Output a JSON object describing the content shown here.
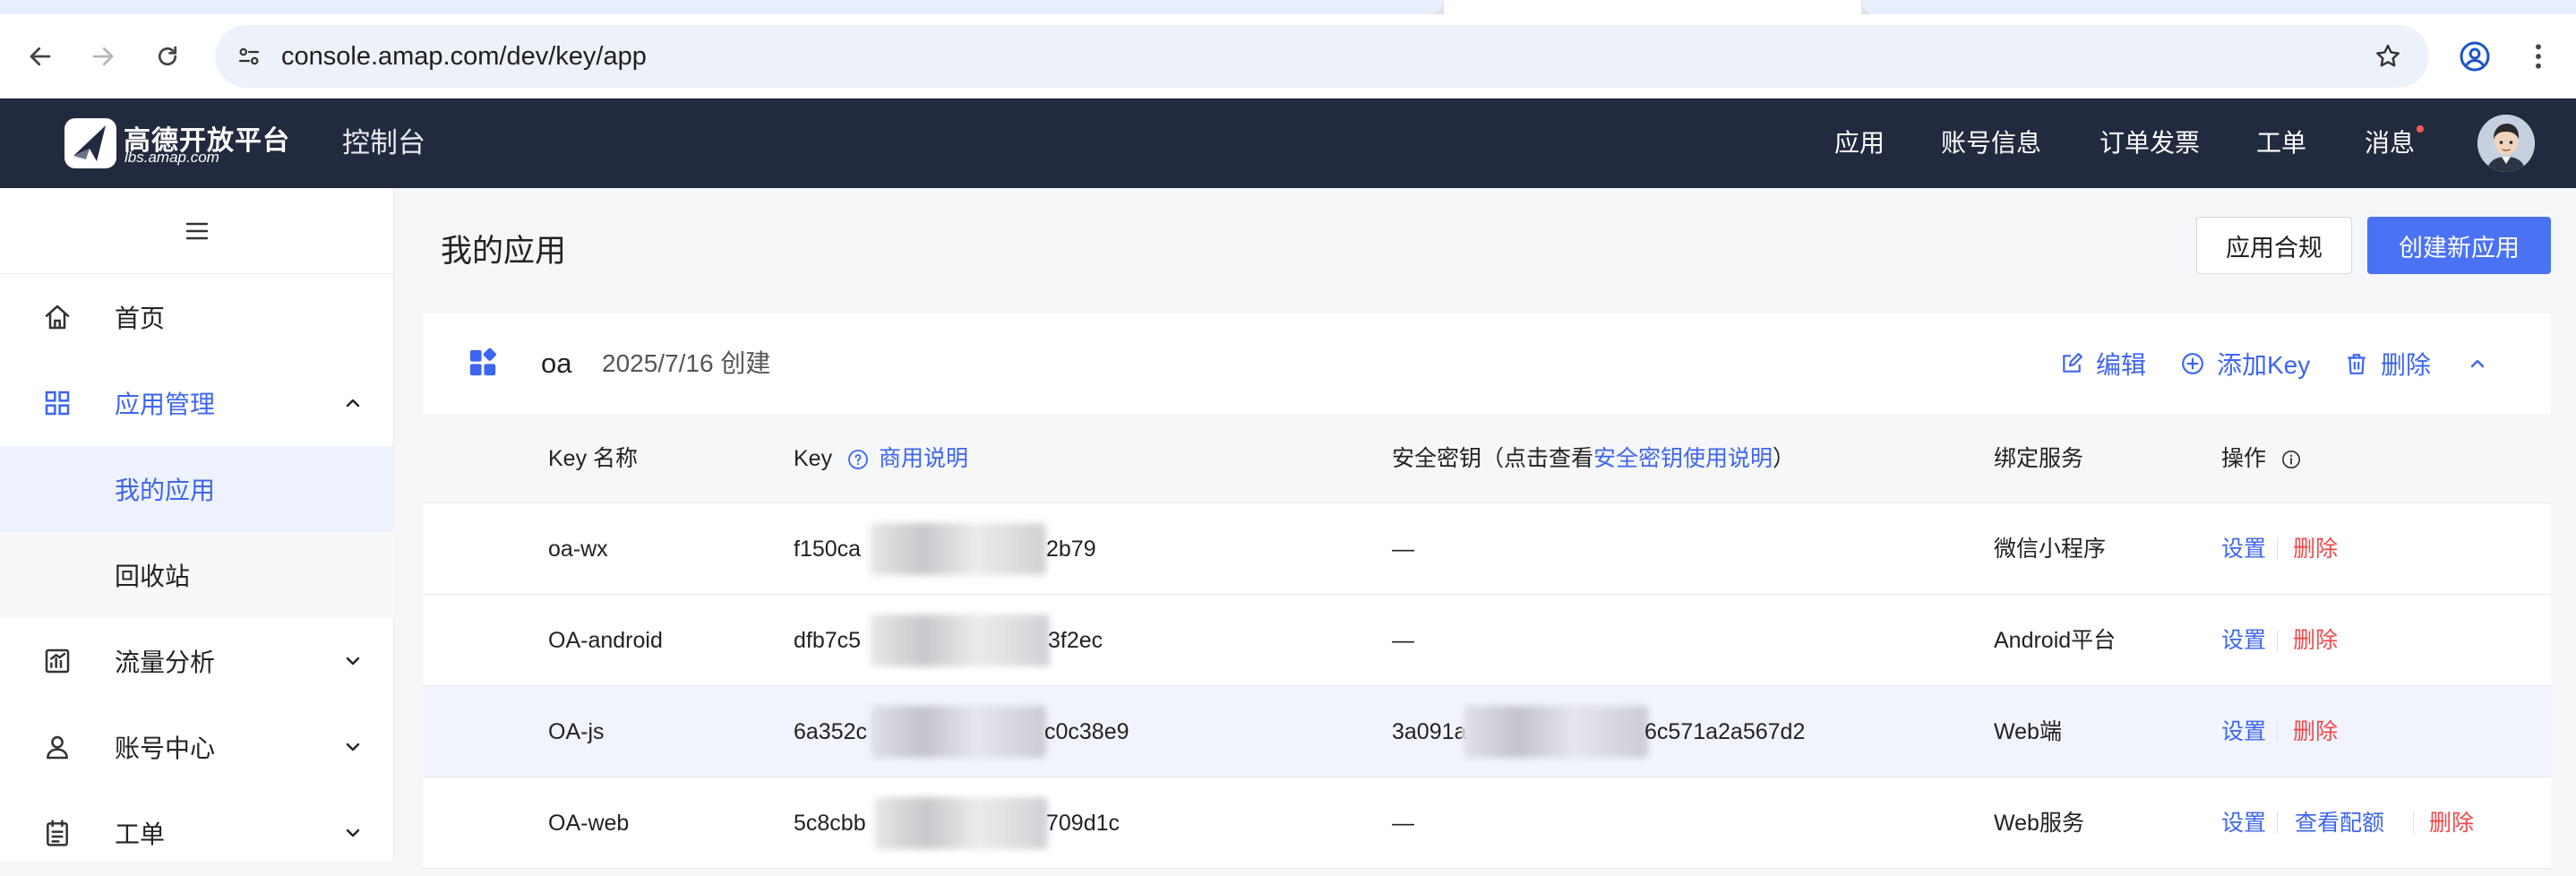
{
  "browser": {
    "url": "console.amap.com/dev/key/app"
  },
  "header": {
    "brand_name": "高德开放平台",
    "brand_domain": "lbs.amap.com",
    "console_title": "控制台",
    "nav": [
      {
        "label": "应用"
      },
      {
        "label": "账号信息"
      },
      {
        "label": "订单发票"
      },
      {
        "label": "工单"
      },
      {
        "label": "消息"
      }
    ],
    "has_unread_messages": true
  },
  "sidebar": {
    "items": [
      {
        "label": "首页",
        "icon": "home-icon"
      },
      {
        "label": "应用管理",
        "icon": "apps-grid-icon",
        "expanded": true
      },
      {
        "label": "我的应用",
        "active": true
      },
      {
        "label": "回收站"
      },
      {
        "label": "流量分析",
        "icon": "chart-icon"
      },
      {
        "label": "账号中心",
        "icon": "user-icon"
      },
      {
        "label": "工单",
        "icon": "ticket-icon"
      }
    ]
  },
  "main": {
    "title": "我的应用",
    "compliance_button": "应用合规",
    "create_button": "创建新应用",
    "app": {
      "name": "oa",
      "created": "2025/7/16 创建",
      "actions": {
        "edit": "编辑",
        "add_key": "添加Key",
        "delete": "删除"
      },
      "columns": {
        "key_name": "Key 名称",
        "key": "Key",
        "key_help": "商用说明",
        "secret_prefix": "安全密钥（点击查看",
        "secret_link": "安全密钥使用说明",
        "secret_suffix": "）",
        "service": "绑定服务",
        "ops": "操作"
      },
      "rows": [
        {
          "name": "oa-wx",
          "key_start": "f150ca",
          "key_end": "2b79",
          "secret": "—",
          "service": "微信小程序",
          "ops": [
            "设置",
            "删除"
          ]
        },
        {
          "name": "OA-android",
          "key_start": "dfb7c5",
          "key_end": "3f2ec",
          "secret": "—",
          "service": "Android平台",
          "ops": [
            "设置",
            "删除"
          ]
        },
        {
          "name": "OA-js",
          "key_start": "6a352c",
          "key_end": "c0c38e9",
          "secret_start": "3a091a",
          "secret_end": "6c571a2a567d2",
          "service": "Web端",
          "ops": [
            "设置",
            "删除"
          ]
        },
        {
          "name": "OA-web",
          "key_start": "5c8cbb",
          "key_end": "709d1c",
          "secret": "—",
          "service": "Web服务",
          "ops": [
            "设置",
            "查看配额",
            "删除"
          ]
        }
      ]
    }
  },
  "colors": {
    "accent": "#3d65f0",
    "header_bg": "#222a3f",
    "danger": "#f0484b"
  }
}
